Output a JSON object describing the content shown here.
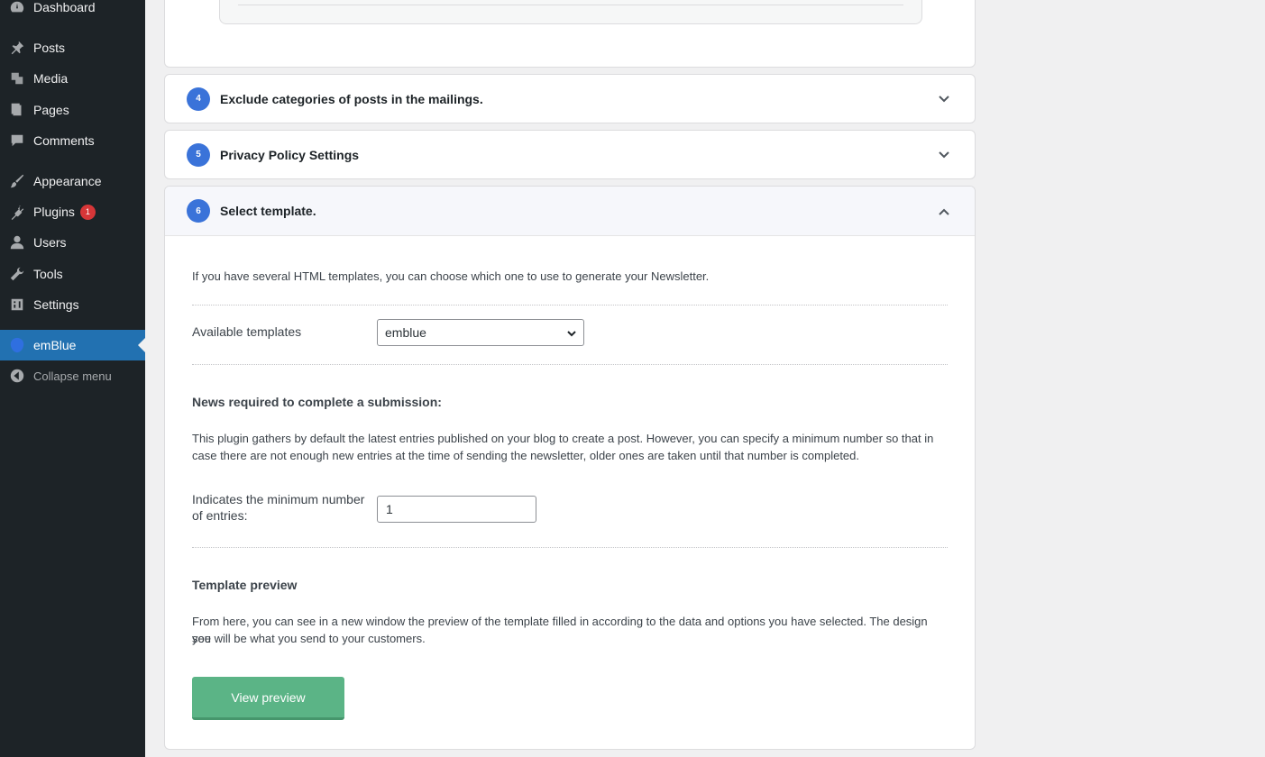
{
  "sidebar": {
    "items": [
      {
        "label": "Dashboard",
        "icon": "dashboard-icon"
      },
      {
        "label": "Posts",
        "icon": "pin-icon"
      },
      {
        "label": "Media",
        "icon": "media-icon"
      },
      {
        "label": "Pages",
        "icon": "pages-icon"
      },
      {
        "label": "Comments",
        "icon": "comment-icon"
      },
      {
        "label": "Appearance",
        "icon": "brush-icon"
      },
      {
        "label": "Plugins",
        "icon": "plugin-icon",
        "badge": "1"
      },
      {
        "label": "Users",
        "icon": "user-icon"
      },
      {
        "label": "Tools",
        "icon": "wrench-icon"
      },
      {
        "label": "Settings",
        "icon": "settings-icon"
      },
      {
        "label": "emBlue",
        "icon": "emblue-drop-icon",
        "active": true
      },
      {
        "label": "Collapse menu",
        "icon": "collapse-icon"
      }
    ]
  },
  "sections": [
    {
      "num": "4",
      "title": "Exclude categories of posts in the mailings."
    },
    {
      "num": "5",
      "title": "Privacy Policy Settings"
    },
    {
      "num": "6",
      "title": "Select template."
    }
  ],
  "template_section": {
    "intro": "If you have several HTML templates, you can choose which one to use to generate your Newsletter.",
    "available_label": "Available templates",
    "available_value": "emblue",
    "news_title": "News required to complete a submission:",
    "news_text_1": "This plugin gathers by default the latest entries published on your blog to create a post. However, you can specify a minimum number so that in",
    "news_text_2": "case there are not enough new entries at the time of sending the newsletter, older ones are taken until that number is completed.",
    "min_label_1": "Indicates the minimum number",
    "min_label_2": "of entries:",
    "min_value": "1",
    "preview_title": "Template preview",
    "preview_text_1": "From here, you can see in a new window the preview of the template filled in according to the data and options you have selected. The design you",
    "preview_text_2": "see will be what you send to your customers.",
    "preview_button": "View preview"
  },
  "colors": {
    "sidebar_bg": "#1d2327",
    "active_bg": "#2271b1",
    "step_badge": "#3a73d9",
    "button": "#5bb486",
    "plugin_badge": "#d63638"
  }
}
